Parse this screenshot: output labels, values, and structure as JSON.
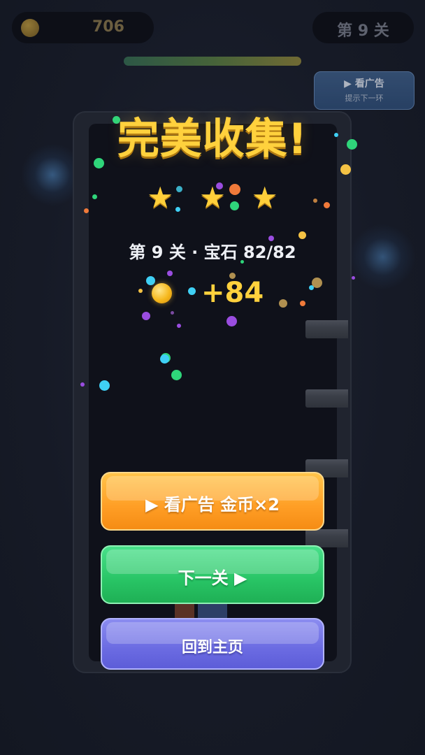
{
  "hud": {
    "coins": "706",
    "level": "第 9 关",
    "hint_button": {
      "line1": "▶ 看广告",
      "line2": "提示下一环"
    }
  },
  "result": {
    "title": "完美收集!",
    "stars": [
      "★",
      "★",
      "★"
    ],
    "summary": "第 9 关 · 宝石 82/82",
    "reward": "+84"
  },
  "buttons": {
    "watch_ad": "▶ 看广告 金币×2",
    "next_level": "下一关 ▶",
    "home": "回到主页"
  },
  "colors": {
    "gold": "#ffd13d",
    "orange_button": "#ff9e25",
    "green_button": "#28c465",
    "purple_button": "#6b6be2",
    "background": "#161a26"
  }
}
